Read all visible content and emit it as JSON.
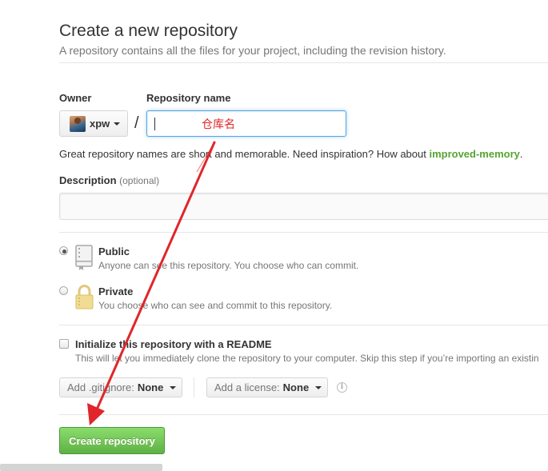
{
  "page": {
    "title": "Create a new repository",
    "subtitle": "A repository contains all the files for your project, including the revision history."
  },
  "owner": {
    "label": "Owner",
    "name": "xpw",
    "separator": "/"
  },
  "repo_name": {
    "label": "Repository name",
    "value": "",
    "annotation": "仓库名",
    "annotation_color": "#e0262a"
  },
  "hint": {
    "text": "Great repository names are short and memorable. Need inspiration? How about ",
    "suggestion": "improved-memory",
    "end": "."
  },
  "description": {
    "label": "Description",
    "optional": "(optional)",
    "value": ""
  },
  "visibility": {
    "selected": "public",
    "public": {
      "title": "Public",
      "desc": "Anyone can see this repository. You choose who can commit.",
      "icon": "repo-book-icon"
    },
    "private": {
      "title": "Private",
      "desc": "You choose who can see and commit to this repository.",
      "icon": "lock-icon"
    }
  },
  "readme": {
    "checked": false,
    "title": "Initialize this repository with a README",
    "desc": "This will let you immediately clone the repository to your computer. Skip this step if you’re importing an existin"
  },
  "gitignore": {
    "label": "Add .gitignore:",
    "value": "None"
  },
  "license": {
    "label": "Add a license:",
    "value": "None"
  },
  "submit": {
    "label": "Create repository"
  },
  "colors": {
    "accent_green": "#55a532",
    "button_green": "#60b044",
    "focus_blue": "#51a7e8",
    "annotation_arrow": "#e0262a"
  }
}
